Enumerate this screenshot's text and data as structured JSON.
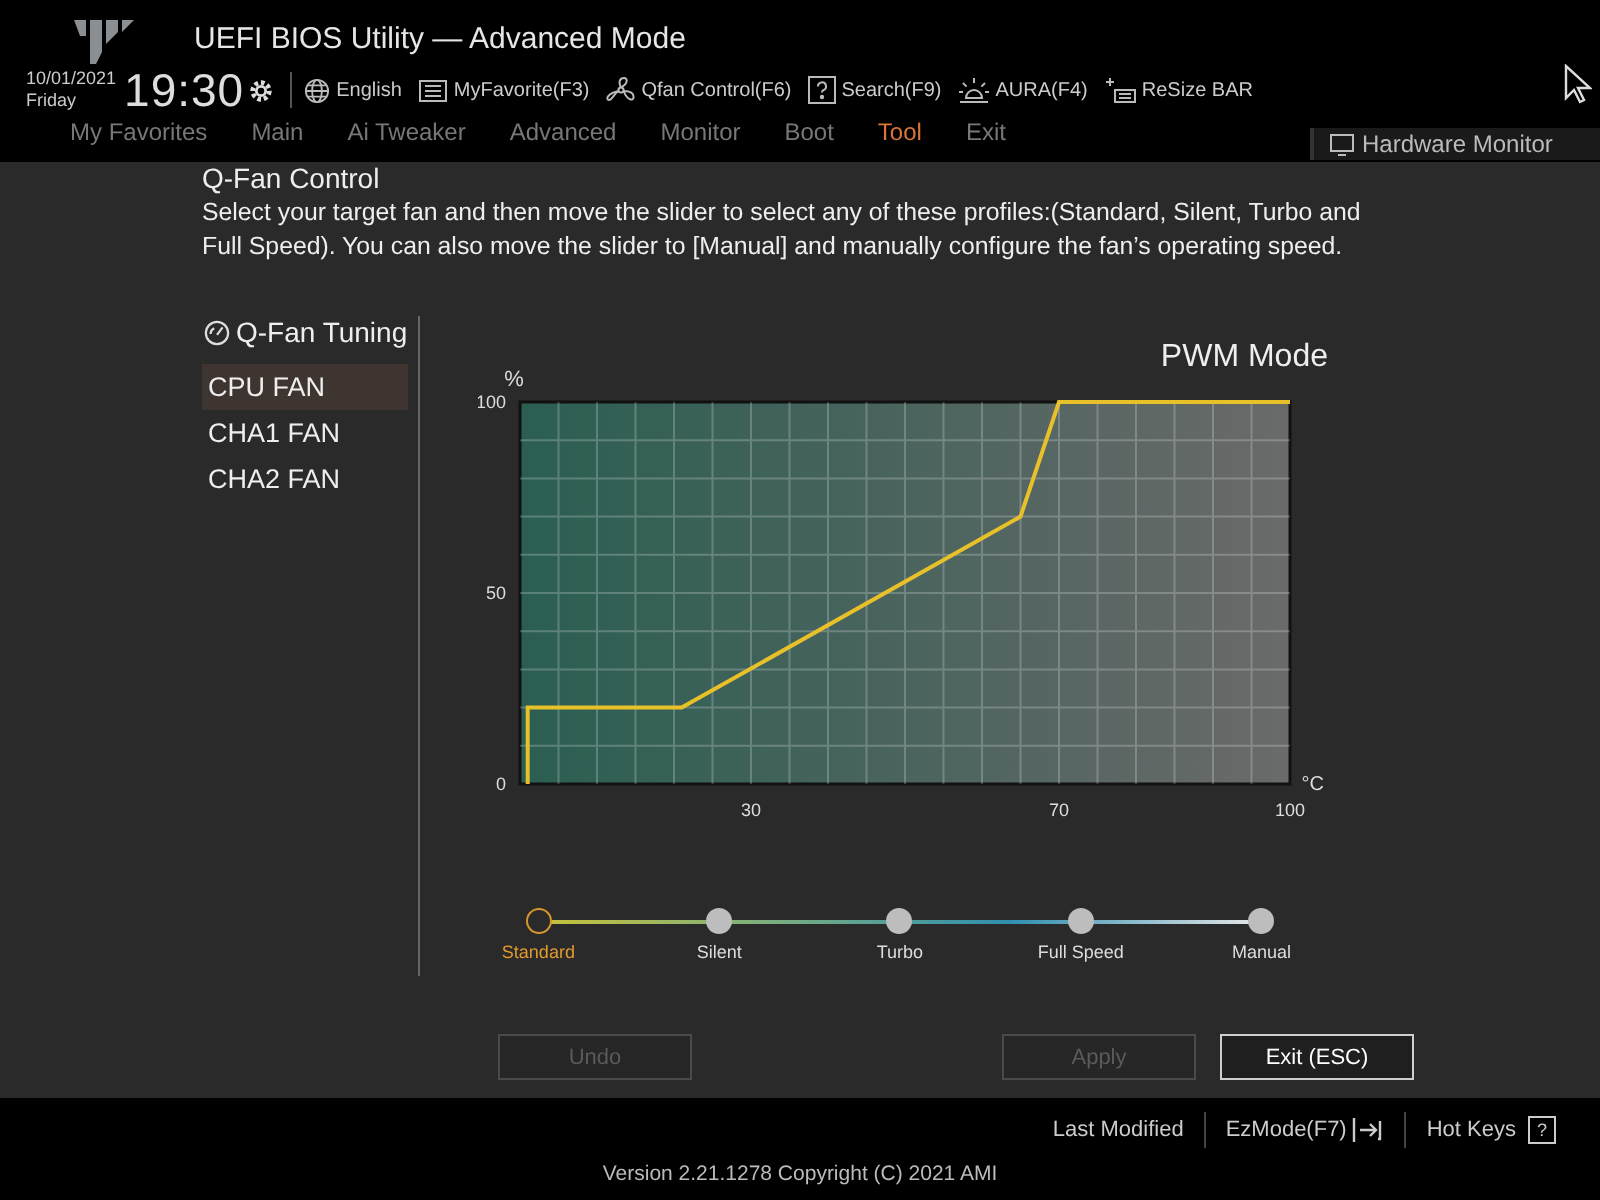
{
  "header": {
    "title": "UEFI BIOS Utility — Advanced Mode",
    "date": "10/01/2021",
    "day": "Friday",
    "time": "19:30",
    "toolbar": [
      {
        "kind": "globe",
        "label": "English"
      },
      {
        "kind": "favorite",
        "label": "MyFavorite(F3)"
      },
      {
        "kind": "fan",
        "label": "Qfan Control(F6)"
      },
      {
        "kind": "search",
        "label": "Search(F9)"
      },
      {
        "kind": "aura",
        "label": "AURA(F4)"
      },
      {
        "kind": "resize",
        "label": "ReSize BAR"
      }
    ],
    "tabs": [
      {
        "label": "My Favorites",
        "selected": false
      },
      {
        "label": "Main",
        "selected": false
      },
      {
        "label": "Ai Tweaker",
        "selected": false
      },
      {
        "label": "Advanced",
        "selected": false
      },
      {
        "label": "Monitor",
        "selected": false
      },
      {
        "label": "Boot",
        "selected": false
      },
      {
        "label": "Tool",
        "selected": true
      },
      {
        "label": "Exit",
        "selected": false
      }
    ],
    "hardware_monitor": "Hardware Monitor"
  },
  "dialog": {
    "title": "Q-Fan Control",
    "description": "Select your target fan and then move the slider to select any of these profiles:(Standard, Silent, Turbo and Full Speed). You can also move the slider to [Manual] and manually configure the fan’s operating speed.",
    "tuning_title": "Q-Fan Tuning",
    "fans": [
      {
        "label": "CPU FAN",
        "selected": true
      },
      {
        "label": "CHA1 FAN",
        "selected": false
      },
      {
        "label": "CHA2 FAN",
        "selected": false
      }
    ],
    "mode": "PWM Mode",
    "chart": {
      "chart_data": {
        "type": "line",
        "xlabel": "°C",
        "ylabel": "%",
        "x": [
          1,
          1,
          21,
          65,
          70,
          100
        ],
        "xlim": [
          0,
          100
        ],
        "ylim": [
          0,
          100
        ],
        "xticks": [
          30,
          70,
          100
        ],
        "yticks": [
          0,
          50,
          100
        ],
        "grid": true,
        "series": [
          {
            "color": "#e8c02a",
            "values": [
              0,
              20,
              20,
              70,
              100,
              100
            ]
          }
        ]
      }
    },
    "profiles": [
      {
        "label": "Standard",
        "selected": true
      },
      {
        "label": "Silent",
        "selected": false
      },
      {
        "label": "Turbo",
        "selected": false
      },
      {
        "label": "Full Speed",
        "selected": false
      },
      {
        "label": "Manual",
        "selected": false
      }
    ],
    "buttons": [
      {
        "label": "Undo",
        "disabled": true
      },
      {
        "label": "Apply",
        "disabled": true
      },
      {
        "label": "Exit (ESC)",
        "disabled": false
      }
    ]
  },
  "footer": {
    "last_modified": "Last Modified",
    "ezmode": "EzMode(F7)",
    "hot_keys": "Hot Keys",
    "hot_keys_key": "?",
    "version": "Version 2.21.1278 Copyright (C) 2021 AMI"
  }
}
